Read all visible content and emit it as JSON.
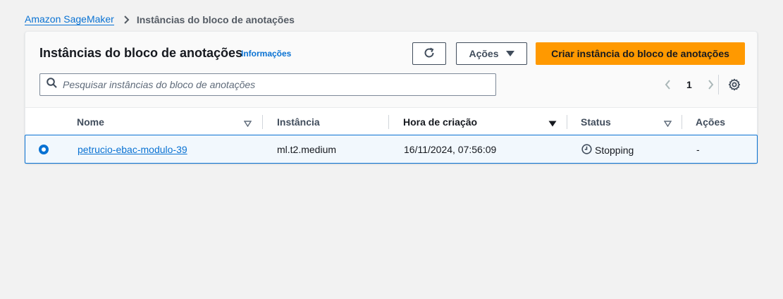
{
  "breadcrumb": {
    "root": "Amazon SageMaker",
    "current": "Instâncias do bloco de anotações"
  },
  "header": {
    "title": "Instâncias do bloco de anotações",
    "info": "Informações",
    "actions_label": "Ações",
    "create_label": "Criar instância do bloco de anotações"
  },
  "search": {
    "placeholder": "Pesquisar instâncias do bloco de anotações",
    "value": ""
  },
  "pagination": {
    "current_page": "1"
  },
  "table": {
    "columns": [
      "Nome",
      "Instância",
      "Hora de criação",
      "Status",
      "Ações"
    ],
    "rows": [
      {
        "name": "petrucio-ebac-modulo-39",
        "instance": "ml.t2.medium",
        "created": "16/11/2024, 07:56:09",
        "status": "Stopping",
        "actions": "-"
      }
    ]
  },
  "colors": {
    "accent": "#0972d3",
    "primary_button": "#ff9900",
    "background": "#f2f2f2"
  },
  "icons": {
    "refresh": "refresh-icon",
    "caret": "caret-down-icon",
    "search": "search-icon",
    "settings": "gear-icon",
    "status": "clock-icon"
  }
}
